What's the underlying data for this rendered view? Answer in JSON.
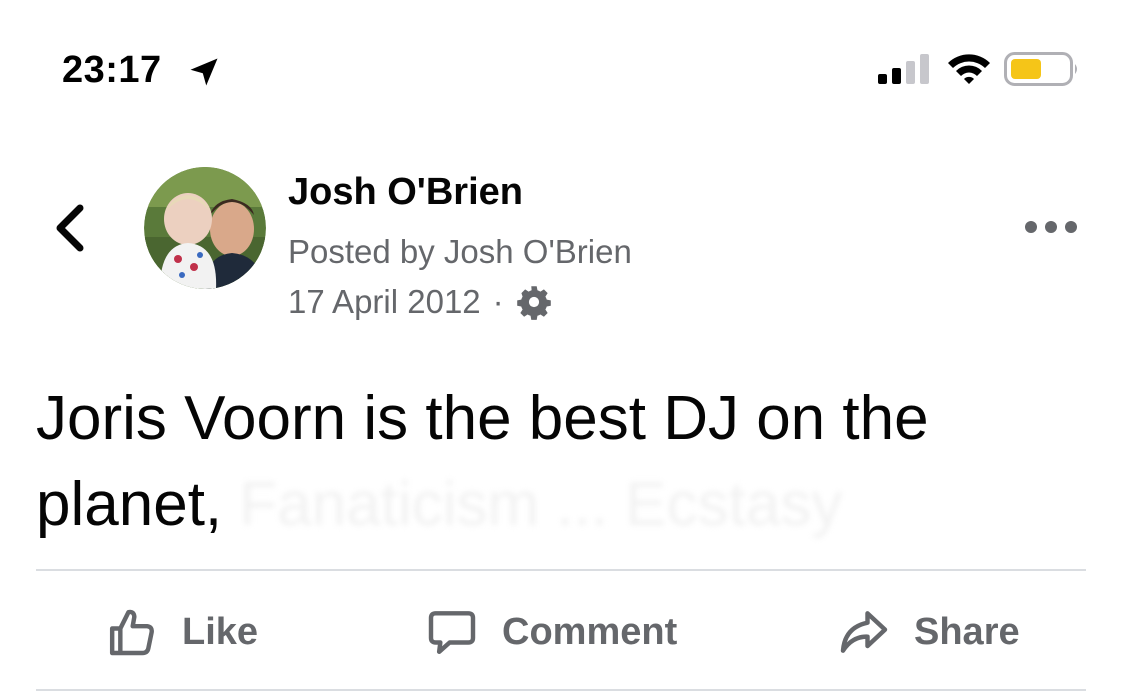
{
  "status_bar": {
    "time": "23:17",
    "icons": [
      "location-arrow-icon",
      "cellular-signal-icon",
      "wifi-icon",
      "battery-icon"
    ],
    "battery_color": "#f5c518"
  },
  "post": {
    "author": "Josh O'Brien",
    "posted_by": "Posted by Josh O'Brien",
    "date": "17 April 2012",
    "separator": "·",
    "privacy_icon": "gear-icon",
    "text_visible": "Joris Voorn is the best DJ on the planet,",
    "text_obscured": "Fanaticism ... Ecstasy"
  },
  "header": {
    "back_icon": "chevron-left-icon",
    "more_icon": "more-horizontal-icon"
  },
  "actions": {
    "like": "Like",
    "comment": "Comment",
    "share": "Share"
  },
  "colors": {
    "primary_text": "#050505",
    "secondary_text": "#65676b",
    "divider": "#dadde1"
  }
}
